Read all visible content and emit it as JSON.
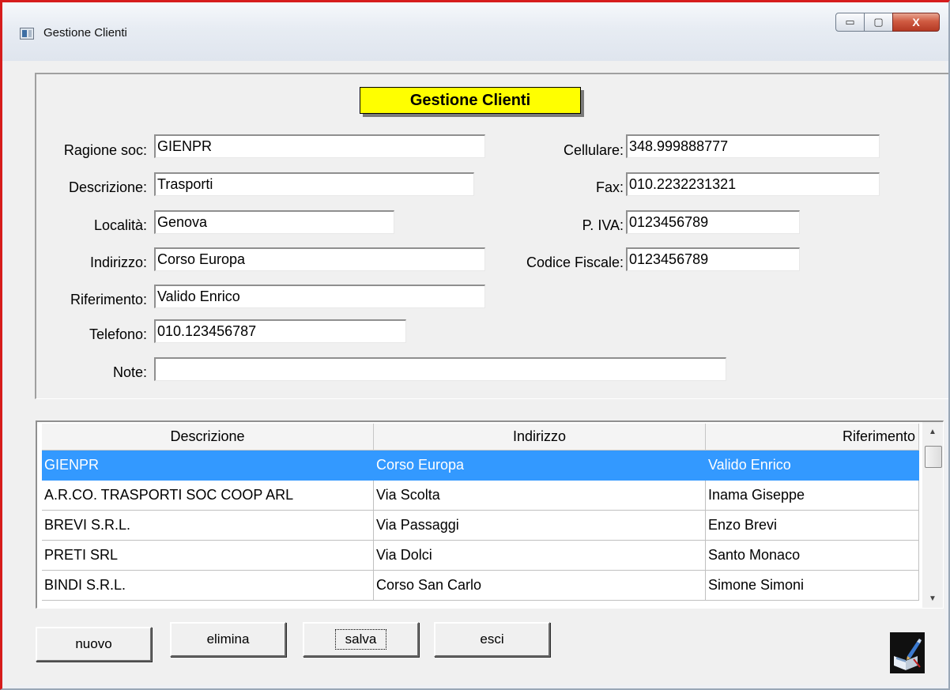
{
  "window": {
    "title": "Gestione Clienti",
    "controls": {
      "minimize_glyph": "▭",
      "maximize_glyph": "▢",
      "close_glyph": "X"
    }
  },
  "form": {
    "heading": "Gestione Clienti",
    "fields": {
      "ragione_soc": {
        "label": "Ragione soc:",
        "value": "GIENPR"
      },
      "descrizione": {
        "label": "Descrizione:",
        "value": "Trasporti"
      },
      "localita": {
        "label": "Località:",
        "value": "Genova"
      },
      "indirizzo": {
        "label": "Indirizzo:",
        "value": "Corso Europa"
      },
      "riferimento": {
        "label": "Riferimento:",
        "value": "Valido Enrico"
      },
      "telefono": {
        "label": "Telefono:",
        "value": "010.123456787"
      },
      "note": {
        "label": "Note:",
        "value": ""
      },
      "cellulare": {
        "label": "Cellulare:",
        "value": "348.999888777"
      },
      "fax": {
        "label": "Fax:",
        "value": "010.2232231321"
      },
      "piva": {
        "label": "P. IVA:",
        "value": "0123456789"
      },
      "codice_fiscale": {
        "label": "Codice Fiscale:",
        "value": "0123456789"
      }
    }
  },
  "table": {
    "columns": [
      "Descrizione",
      "Indirizzo",
      "Riferimento"
    ],
    "rows": [
      [
        "GIENPR",
        "Corso Europa",
        "Valido Enrico"
      ],
      [
        "A.R.CO. TRASPORTI SOC COOP ARL",
        "Via Scolta",
        "Inama Giseppe"
      ],
      [
        "BREVI S.R.L.",
        "Via Passaggi",
        "Enzo Brevi"
      ],
      [
        "PRETI SRL",
        "Via Dolci",
        "Santo Monaco"
      ],
      [
        "BINDI S.R.L.",
        "Corso San Carlo",
        "Simone Simoni"
      ]
    ],
    "selected_row": 0,
    "scroll": {
      "up_glyph": "▲",
      "down_glyph": "▼"
    }
  },
  "buttons": {
    "nuovo": "nuovo",
    "elimina": "elimina",
    "salva": "salva",
    "esci": "esci"
  },
  "colors": {
    "heading_bg": "#ffff00",
    "selection": "#3399ff",
    "window_frame": "#d61c1c"
  },
  "icons": {
    "app": "window-app-icon",
    "decoration": "book-pen-icon"
  }
}
